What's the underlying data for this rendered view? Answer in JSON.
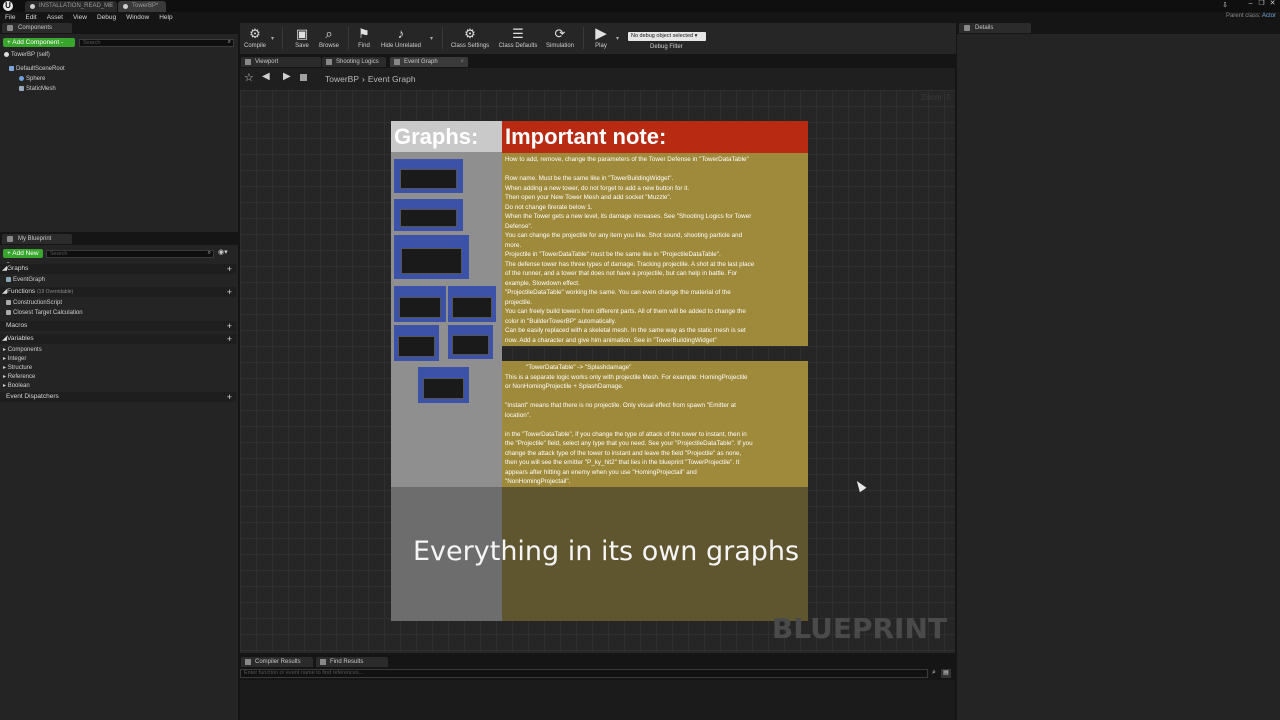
{
  "titlebar": {
    "tabs": [
      "INSTALLATION_READ_ME",
      "TowerBP*"
    ],
    "parent_class_label": "Parent class:",
    "parent_class_value": "Actor",
    "window_controls": [
      "–",
      "❐",
      "✕"
    ]
  },
  "menu": [
    "File",
    "Edit",
    "Asset",
    "View",
    "Debug",
    "Window",
    "Help"
  ],
  "components": {
    "tab": "Components",
    "add_button": "+ Add Component -",
    "search_placeholder": "Search",
    "self_item": "TowerBP (self)",
    "tree": [
      "DefaultSceneRoot",
      "Sphere",
      "StaticMesh"
    ]
  },
  "my_blueprint": {
    "tab": "My Blueprint",
    "add_button": "+ Add New -",
    "search_placeholder": "Search",
    "graphs_label": "Graphs",
    "graphs_items": [
      "EventGraph"
    ],
    "functions_label": "Functions",
    "functions_sub": "(19 Overridable)",
    "functions_items": [
      "ConstructionScript",
      "Closest Target Calculation"
    ],
    "macros_label": "Macros",
    "variables_label": "Variables",
    "variable_groups": [
      "Components",
      "Integer",
      "Structure",
      "Reference",
      "Boolean"
    ],
    "dispatchers_label": "Event Dispatchers"
  },
  "toolbar": {
    "compile": "Compile",
    "save": "Save",
    "browse": "Browse",
    "find": "Find",
    "hide_unrelated": "Hide Unrelated",
    "class_settings": "Class Settings",
    "class_defaults": "Class Defaults",
    "simulation": "Simulation",
    "play": "Play",
    "debug_select": "No debug object selected ▾",
    "debug_filter": "Debug Filter"
  },
  "editor_tabs": [
    "Viewport",
    "Shooting Logics Fo",
    "Event Graph"
  ],
  "breadcrumb": {
    "root": "TowerBP",
    "current": "Event Graph"
  },
  "graph": {
    "zoom": "Zoom -5",
    "watermark": "BLUEPRINT",
    "graphs_title": "Graphs:",
    "note_title": "Important note:",
    "note_lines": [
      "How to add, remove, change the parameters of the Tower Defense in \"TowerDataTable\"",
      "",
      "Row name. Must be the same like in \"TowerBuildingWidget\".",
      "When adding a new tower, do not forget to add a new button for it.",
      "Then open your New Tower Mesh and add socket \"Muzzle\".",
      "Do not change firerate below 1.",
      "When the Tower gets a new level, its damage increases. See \"Shooting Logics for Tower",
      "Defense\".",
      "You can change the projectile for any item you like. Shot sound, shooting particle and",
      "more.",
      "Projectile in \"TowerDataTable\" must be the same like in \"ProjectileDataTable\".",
      "The defense tower has three types of damage. Tracking projectile. A shot at the last place",
      "of the runner, and a tower that does not have a projectile, but can help in battle. For",
      "example, Slowdown effect.",
      "\"ProjectileDataTable\" working the same. You can even change the material of the",
      "projectile.",
      "You can freely build towers from different parts. All of them will be added to change the",
      "color in \"BuilderTowerBP\" automatically.",
      "Can be easily replaced with a skeletal mesh. In the same way as the static mesh is set",
      "now. Add a character and give him animation. See in \"TowerBuildingWidget\""
    ],
    "splash_lines": [
      "            \"TowerDataTable\" -> \"Splashdamage\"",
      "This is a separate logic works only with projectile Mesh. For example: HomingProjectile",
      "or NonHomingProjectile + SplashDamage.",
      "",
      "\"Instant\" means that there is no projectile. Only visual effect from spawn \"Emitter at",
      "location\".",
      "",
      "in the \"TowerDataTable\", if you change the type of attack of the tower to instant, then in",
      "the \"Projectile\" field, select any type that you need. See your \"ProjectileDataTable\". If you",
      "change the attack type of the tower to instant and leave the field \"Projectile\" as none,",
      "then you will see the emitter \"P_ky_hit2\" that lies in the blueprint \"TowerProjectile\". It",
      "appears after hitting an enemy when you use \"HomingProjectail\" and",
      "\"NonHomingProjectail\"."
    ],
    "caption": "Everything in its own graphs"
  },
  "bottom": {
    "tabs": [
      "Compiler Results",
      "Find Results"
    ],
    "find_placeholder": "Enter function or event name to find references..."
  },
  "details": {
    "tab": "Details"
  }
}
